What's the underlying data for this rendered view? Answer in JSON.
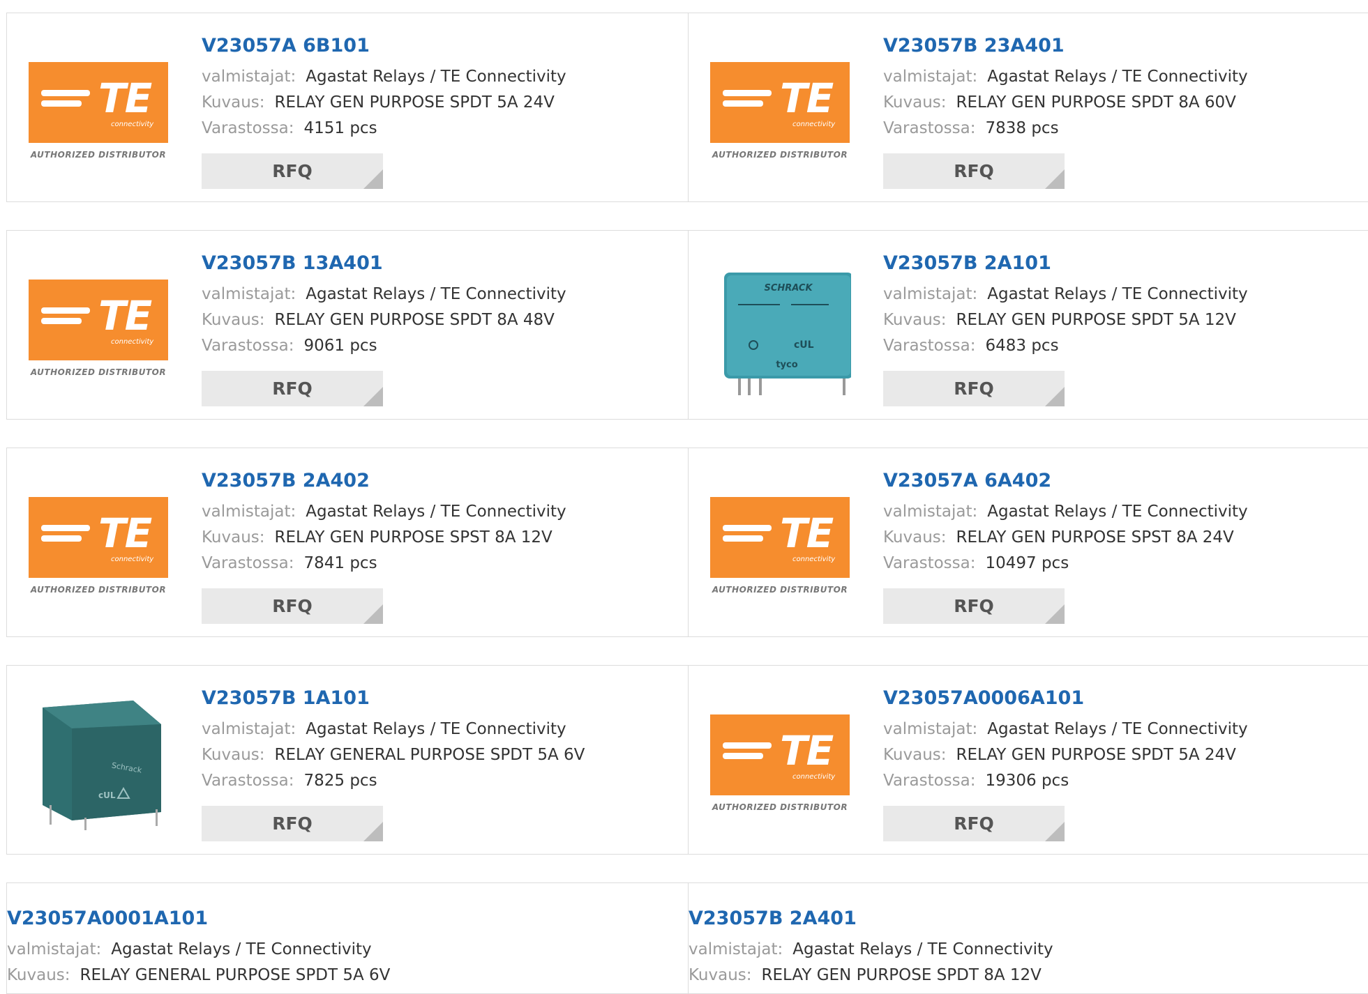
{
  "labels": {
    "manufacturer": "valmistajat:",
    "description": "Kuvaus:",
    "stock": "Varastossa:",
    "rfq": "RFQ"
  },
  "te_logo": {
    "word": "TE",
    "sub": "connectivity",
    "authorized": "AUTHORIZED DISTRIBUTOR"
  },
  "relay_marks": {
    "schrack_upper": "SCHRACK",
    "tyco": "tyco",
    "schrack_title": "Schrack"
  },
  "products": [
    {
      "part": "V23057A 6B101",
      "manufacturer": "Agastat Relays / TE Connectivity",
      "description": "RELAY GEN PURPOSE SPDT 5A 24V",
      "stock": "4151 pcs",
      "image": "te-logo"
    },
    {
      "part": "V23057B 23A401",
      "manufacturer": "Agastat Relays / TE Connectivity",
      "description": "RELAY GEN PURPOSE SPDT 8A 60V",
      "stock": "7838 pcs",
      "image": "te-logo"
    },
    {
      "part": "V23057B 13A401",
      "manufacturer": "Agastat Relays / TE Connectivity",
      "description": "RELAY GEN PURPOSE SPDT 8A 48V",
      "stock": "9061 pcs",
      "image": "te-logo"
    },
    {
      "part": "V23057B 2A101",
      "manufacturer": "Agastat Relays / TE Connectivity",
      "description": "RELAY GEN PURPOSE SPDT 5A 12V",
      "stock": "6483 pcs",
      "image": "relay-photo-blue"
    },
    {
      "part": "V23057B 2A402",
      "manufacturer": "Agastat Relays / TE Connectivity",
      "description": "RELAY GEN PURPOSE SPST 8A 12V",
      "stock": "7841 pcs",
      "image": "te-logo"
    },
    {
      "part": "V23057A 6A402",
      "manufacturer": "Agastat Relays / TE Connectivity",
      "description": "RELAY GEN PURPOSE SPST 8A 24V",
      "stock": "10497 pcs",
      "image": "te-logo"
    },
    {
      "part": "V23057B 1A101",
      "manufacturer": "Agastat Relays / TE Connectivity",
      "description": "RELAY GENERAL PURPOSE SPDT 5A 6V",
      "stock": "7825 pcs",
      "image": "relay-photo-green"
    },
    {
      "part": "V23057A0006A101",
      "manufacturer": "Agastat Relays / TE Connectivity",
      "description": "RELAY GEN PURPOSE SPDT 5A 24V",
      "stock": "19306 pcs",
      "image": "te-logo"
    },
    {
      "part": "V23057A0001A101",
      "manufacturer": "Agastat Relays / TE Connectivity",
      "description": "RELAY GENERAL PURPOSE SPDT 5A 6V",
      "image": "none"
    },
    {
      "part": "V23057B 2A401",
      "manufacturer": "Agastat Relays / TE Connectivity",
      "description": "RELAY GEN PURPOSE SPDT 8A 12V",
      "image": "none"
    }
  ],
  "colors": {
    "link": "#1f67b0",
    "label": "#9a9a9a",
    "te_orange": "#f68d2e",
    "rfq_bg": "#e9e9e9",
    "border": "#dcdcdc"
  }
}
